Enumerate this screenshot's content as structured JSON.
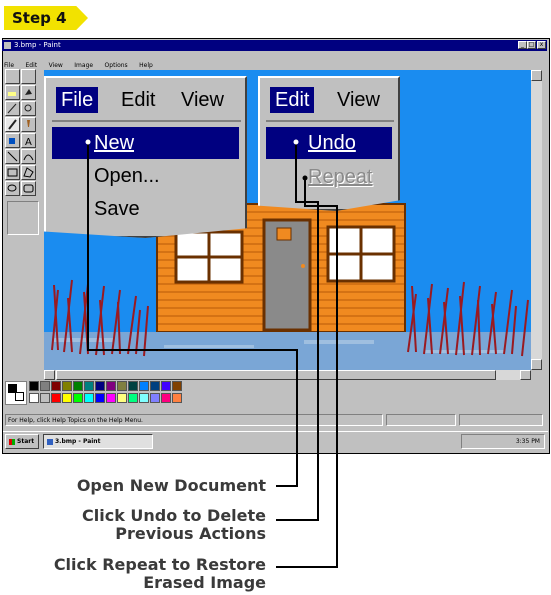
{
  "step_label": "Step 4",
  "window": {
    "title": "3.bmp - Paint",
    "menu": [
      "File",
      "Edit",
      "View",
      "Image",
      "Options",
      "Help"
    ],
    "min": "_",
    "max": "□",
    "close": "x"
  },
  "file_menu": {
    "headers": [
      "File",
      "Edit",
      "View"
    ],
    "items": [
      {
        "label": "New",
        "state": "selected"
      },
      {
        "label": "Open...",
        "state": "normal"
      },
      {
        "label": "Save",
        "state": "normal"
      }
    ]
  },
  "edit_menu": {
    "headers": [
      "Edit",
      "View"
    ],
    "items": [
      {
        "label": "Undo",
        "state": "selected"
      },
      {
        "label": "Repeat",
        "state": "disabled"
      }
    ]
  },
  "status_bar": {
    "help_text": "For Help, click Help Topics on the Help Menu.",
    "coords": "",
    "size": ""
  },
  "taskbar": {
    "start": "Start",
    "task": "3.bmp - Paint",
    "clock": "3:35 PM"
  },
  "callouts": {
    "open_new": "Open New Document",
    "undo_1": "Click Undo to Delete",
    "undo_2": "Previous Actions",
    "repeat_1": "Click Repeat to Restore",
    "repeat_2": "Erased Image"
  },
  "colors": {
    "canvas_sky": "#1a8cf0",
    "house": "#f08a20",
    "menu_highlight": "#000080",
    "step_tag": "#f2e200"
  }
}
